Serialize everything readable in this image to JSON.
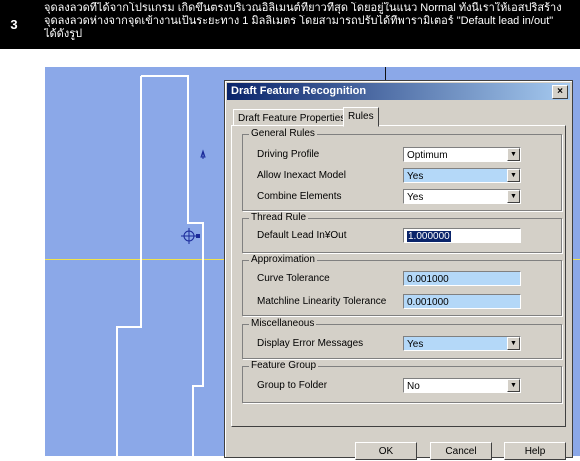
{
  "header": {
    "step": "3",
    "lines": [
      "จุดลงลวดที่ได้จากโปรแกรม เกิดขึ้นตรงบริเวณอิลิเมนต์ที่ยาวที่สุด โดยอยู่ในแนว Normal ทั้งนี้เราให้เอสปริสร้าง",
      "จุดลงลวดห่างจากจุดเข้างานเป็นระยะทาง 1 มิลลิเมตร โดยสามารถปรับได้ที่พารามิเตอร์ \"Default lead in/out\"",
      "ได้ดังรูป"
    ]
  },
  "dialog": {
    "title": "Draft Feature Recognition",
    "close": "×",
    "tabs": {
      "properties": "Draft Feature Properties",
      "rules": "Rules"
    },
    "general": {
      "label": "General Rules",
      "driving_profile": {
        "label": "Driving Profile",
        "value": "Optimum"
      },
      "allow_inexact": {
        "label": "Allow Inexact Model",
        "value": "Yes"
      },
      "combine": {
        "label": "Combine Elements",
        "value": "Yes"
      }
    },
    "thread": {
      "label": "Thread Rule",
      "lead": {
        "label": "Default Lead In¥Out",
        "value": "1.000000"
      }
    },
    "approx": {
      "label": "Approximation",
      "curve_tol": {
        "label": "Curve Tolerance",
        "value": "0.001000"
      },
      "matchline_tol": {
        "label": "Matchline Linearity Tolerance",
        "value": "0.001000"
      }
    },
    "misc": {
      "label": "Miscellaneous",
      "display_err": {
        "label": "Display Error Messages",
        "value": "Yes"
      }
    },
    "group": {
      "label": "Feature Group",
      "to_folder": {
        "label": "Group to Folder",
        "value": "No"
      }
    },
    "buttons": {
      "ok": "OK",
      "cancel": "Cancel",
      "help": "Help"
    }
  },
  "colors": {
    "canvas": "#8ba8e8",
    "title_start": "#0a246a",
    "title_end": "#a6caf0",
    "field_highlight": "#b4d8f8"
  }
}
